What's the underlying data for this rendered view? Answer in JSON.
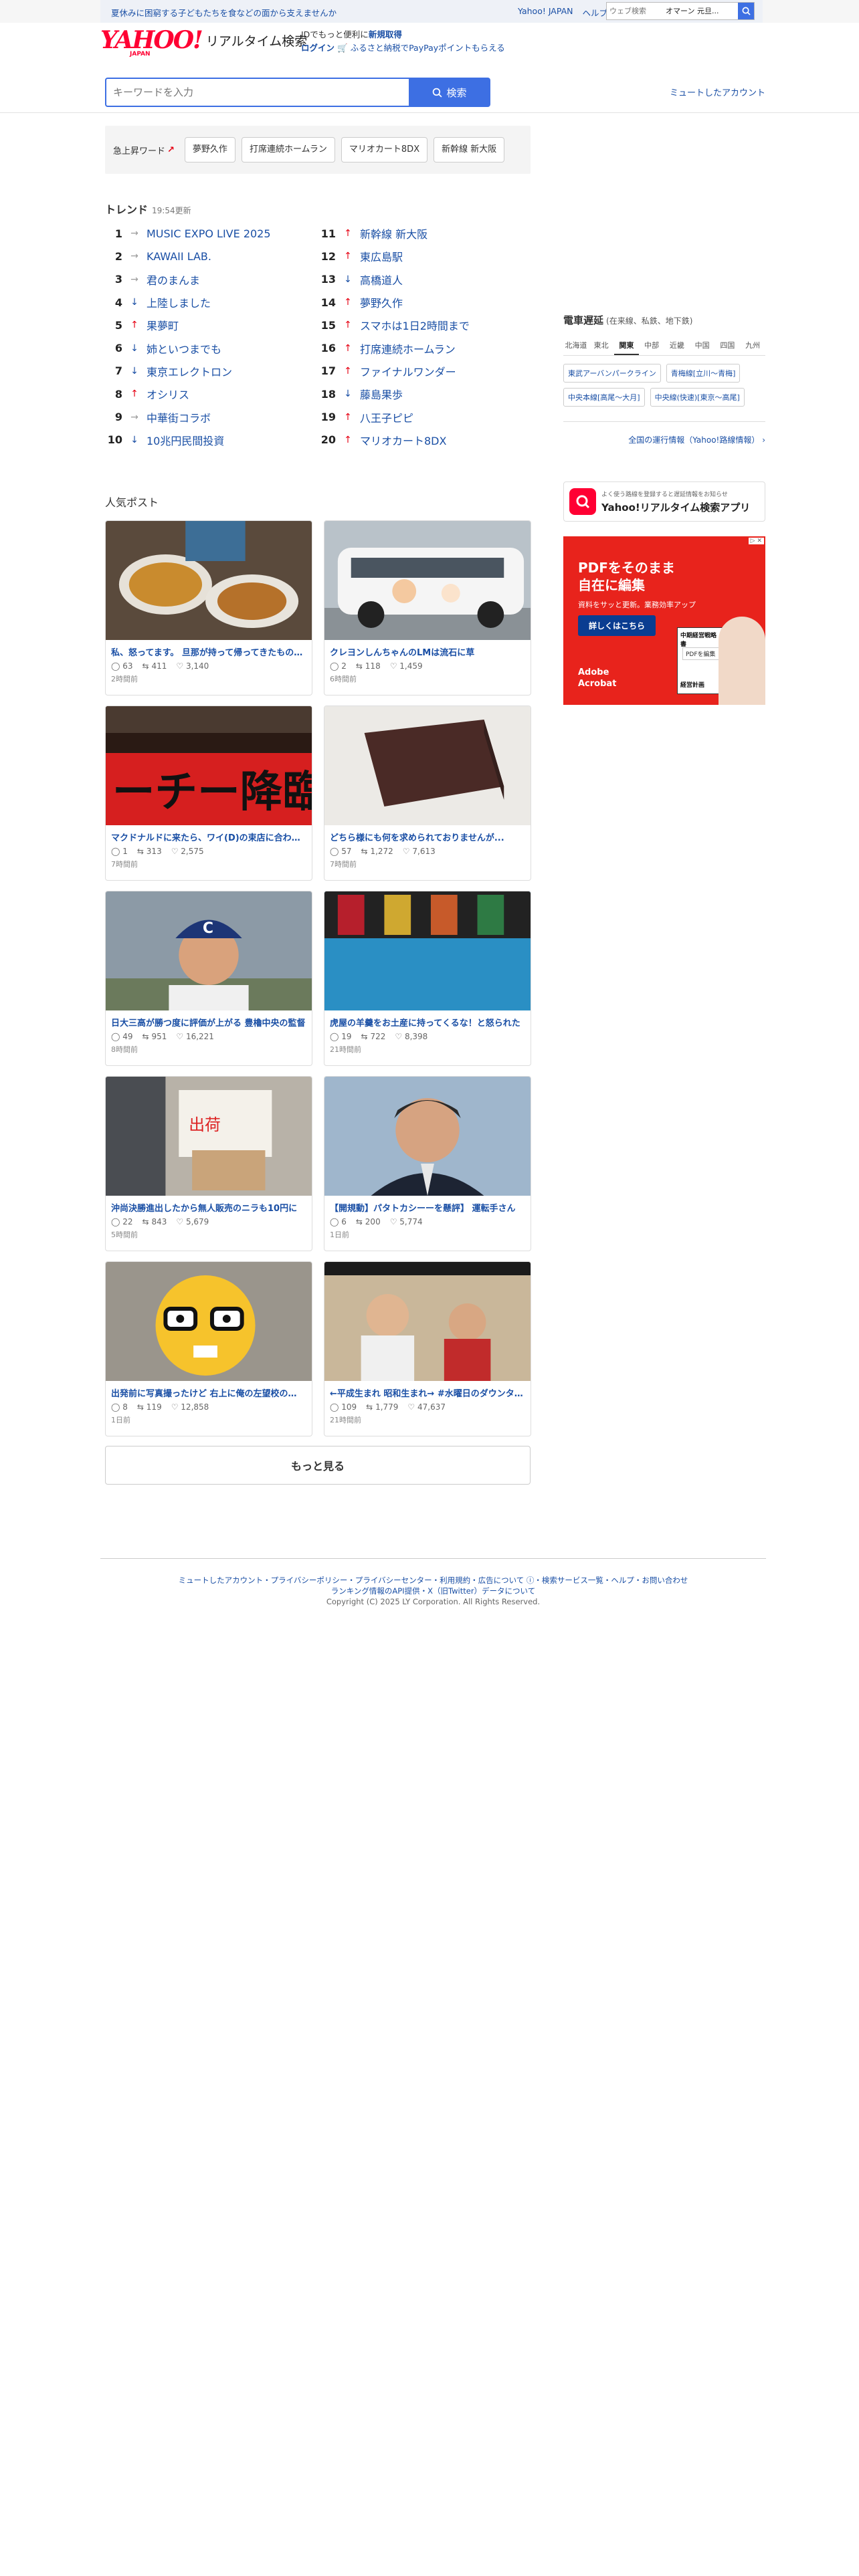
{
  "topbar": {
    "message": "夏休みに困窮する子どもたちを食などの面から支えませんか",
    "links": [
      "Yahoo! JAPAN",
      "ヘルプ"
    ],
    "websearch_placeholder": "ウェブ検索",
    "websearch_suggest": "オマーン 元旦..."
  },
  "header": {
    "logo_text": "YAHOO!",
    "logo_sub": "JAPAN",
    "logo_title": "リアルタイム検索",
    "id_text": "IDでもっと便利に",
    "signup": "新規取得",
    "login": "ログイン",
    "promo": "ふるさと納税でPayPayポイントもらえる"
  },
  "search": {
    "placeholder": "キーワードを入力",
    "button": "検索",
    "muted_accounts": "ミュートしたアカウント"
  },
  "hotwords": {
    "label": "急上昇ワード",
    "items": [
      "夢野久作",
      "打席連続ホームラン",
      "マリオカート8DX",
      "新幹線 新大阪"
    ]
  },
  "trend": {
    "title": "トレンド",
    "updated": "19:54更新",
    "left": [
      {
        "rank": "1",
        "dir": "flat",
        "name": "MUSIC EXPO LIVE 2025"
      },
      {
        "rank": "2",
        "dir": "flat",
        "name": "KAWAII LAB."
      },
      {
        "rank": "3",
        "dir": "flat",
        "name": "君のまんま"
      },
      {
        "rank": "4",
        "dir": "down",
        "name": "上陸しました"
      },
      {
        "rank": "5",
        "dir": "up",
        "name": "果夢町"
      },
      {
        "rank": "6",
        "dir": "down",
        "name": "姉といつまでも"
      },
      {
        "rank": "7",
        "dir": "down",
        "name": "東京エレクトロン"
      },
      {
        "rank": "8",
        "dir": "up",
        "name": "オシリス"
      },
      {
        "rank": "9",
        "dir": "flat",
        "name": "中華街コラボ"
      },
      {
        "rank": "10",
        "dir": "down",
        "name": "10兆円民間投資"
      }
    ],
    "right": [
      {
        "rank": "11",
        "dir": "up",
        "name": "新幹線 新大阪"
      },
      {
        "rank": "12",
        "dir": "up",
        "name": "東広島駅"
      },
      {
        "rank": "13",
        "dir": "down",
        "name": "高橋道人"
      },
      {
        "rank": "14",
        "dir": "up",
        "name": "夢野久作"
      },
      {
        "rank": "15",
        "dir": "up",
        "name": "スマホは1日2時間まで"
      },
      {
        "rank": "16",
        "dir": "up",
        "name": "打席連続ホームラン"
      },
      {
        "rank": "17",
        "dir": "up",
        "name": "ファイナルワンダー"
      },
      {
        "rank": "18",
        "dir": "down",
        "name": "藤島果歩"
      },
      {
        "rank": "19",
        "dir": "up",
        "name": "八王子ピピ"
      },
      {
        "rank": "20",
        "dir": "up",
        "name": "マリオカート8DX"
      }
    ]
  },
  "popular": {
    "title": "人気ポスト",
    "posts": [
      {
        "title": "私、怒ってます。 旦那が持って帰ってきたものです",
        "replies": "63",
        "reposts": "411",
        "likes": "3,140",
        "time": "2時間前",
        "img": "food"
      },
      {
        "title": "クレヨンしんちゃんのLMは流石に草",
        "replies": "2",
        "reposts": "118",
        "likes": "1,459",
        "time": "6時間前",
        "img": "van"
      },
      {
        "title": "マクドナルドに来たら、ワイ(D)の束店に合わせて",
        "replies": "1",
        "reposts": "313",
        "likes": "2,575",
        "time": "7時間前",
        "img": "sign"
      },
      {
        "title": "どちら様にも何を求められておりませんが...",
        "replies": "57",
        "reposts": "1,272",
        "likes": "7,613",
        "time": "7時間前",
        "img": "yokan"
      },
      {
        "title": "日大三高が勝つ度に評価が上がる 豊櫓中央の監督",
        "replies": "49",
        "reposts": "951",
        "likes": "16,221",
        "time": "8時間前",
        "img": "coach"
      },
      {
        "title": "虎屋の羊羹をお土産に持ってくるな！と怒られた",
        "replies": "19",
        "reposts": "722",
        "likes": "8,398",
        "time": "21時間前",
        "img": "box"
      },
      {
        "title": "沖尚決勝進出したから無人販売のニラも10円に",
        "replies": "22",
        "reposts": "843",
        "likes": "5,679",
        "time": "5時間前",
        "img": "stall"
      },
      {
        "title": "【開規動】パタトカシーーを懸評】 運転手さん",
        "replies": "6",
        "reposts": "200",
        "likes": "5,774",
        "time": "1日前",
        "img": "man"
      },
      {
        "title": "出発前に写真撮ったけど 右上に俺の左望校の…",
        "replies": "8",
        "reposts": "119",
        "likes": "12,858",
        "time": "1日前",
        "img": "emoji"
      },
      {
        "title": "←平成生まれ 昭和生まれ→ #水曜日のダウンタウン",
        "replies": "109",
        "reposts": "1,779",
        "likes": "47,637",
        "time": "21時間前",
        "img": "tv"
      }
    ],
    "more": "もっと見る"
  },
  "train": {
    "title": "電車遅延",
    "subtitle": "(在来線、私鉄、地下鉄)",
    "tabs": [
      "北海道",
      "東北",
      "関東",
      "中部",
      "近畿",
      "中国",
      "四国",
      "九州"
    ],
    "active_tab": "関東",
    "lines": [
      "東武アーバンパークライン",
      "青梅線[立川〜青梅]",
      "中央本線[高尾〜大月]",
      "中央線(快速)[東京〜高尾]"
    ],
    "all_info": "全国の運行情報（Yahoo!路線情報）"
  },
  "app_banner": {
    "small": "よく使う路線を登録すると遅延情報をお知らせ",
    "big": "Yahoo!リアルタイム検索アプリ"
  },
  "ad": {
    "headline1": "PDFをそのまま",
    "headline2": "自在に編集",
    "sub": "資料をサッと更新。業務効率アップ",
    "cta": "詳しくはこちら",
    "brand1": "Adobe",
    "brand2": "Acrobat",
    "book": "中期経営戦略書",
    "book2": "経営計画",
    "tag": "PDFを編集"
  },
  "footer": {
    "line1": "ミュートしたアカウント・プライバシーポリシー・プライバシーセンター・利用規約・広告について ⓘ・検索サービス一覧・ヘルプ・お問い合わせ",
    "line2": "ランキング情報のAPI提供・X（旧Twitter）データについて",
    "line3": "Copyright (C) 2025 LY Corporation. All Rights Reserved."
  },
  "colors": {
    "link": "#1a4fa5",
    "accent": "#3d6fe3",
    "brand": "#ff0033",
    "up": "#e60012"
  }
}
